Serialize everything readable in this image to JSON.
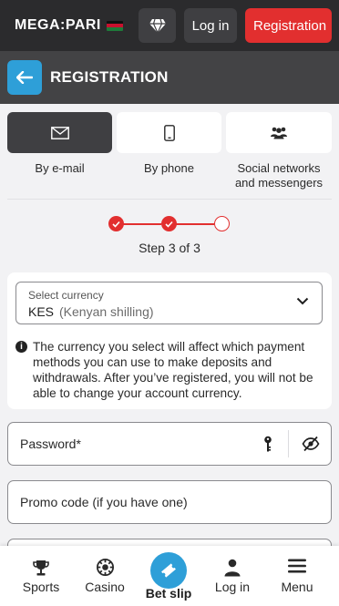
{
  "header": {
    "logo_text": "MEGA:PARI",
    "login_label": "Log in",
    "register_label": "Registration",
    "accent_color": "#e22f2f"
  },
  "registration_bar": {
    "title": "REGISTRATION",
    "back_icon": "arrow-left-icon"
  },
  "methods": [
    {
      "label": "By e-mail",
      "icon": "envelope-icon",
      "active": true
    },
    {
      "label": "By phone",
      "icon": "phone-icon",
      "active": false
    },
    {
      "label": "Social networks and messengers",
      "icon": "people-icon",
      "active": false
    }
  ],
  "steps": {
    "text": "Step 3 of 3",
    "completed": 2,
    "total": 3
  },
  "currency": {
    "label": "Select currency",
    "code": "KES",
    "name": "(Kenyan shilling)",
    "info": "The currency you select will affect which payment methods you can use to make deposits and withdrawals. After you’ve registered, you will not be able to change your account currency."
  },
  "fields": {
    "password_placeholder": "Password*",
    "promo_placeholder": "Promo code (if you have one)"
  },
  "bottom_nav": {
    "sports": "Sports",
    "casino": "Casino",
    "bet_slip": "Bet slip",
    "login": "Log in",
    "menu": "Menu"
  }
}
